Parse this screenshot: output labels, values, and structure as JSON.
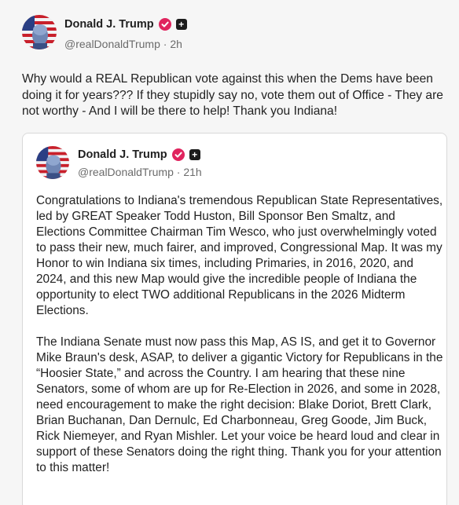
{
  "post": {
    "author_name": "Donald J. Trump",
    "handle": "@realDonaldTrump",
    "separator": " · ",
    "time": "2h",
    "text": "Why would a REAL Republican vote against this when the Dems have been doing it for years??? If they stupidly say no, vote them out of Office - They are not worthy - And I will be there to help! Thank you Indiana!"
  },
  "quoted_post": {
    "author_name": "Donald J. Trump",
    "handle": "@realDonaldTrump",
    "separator": " · ",
    "time": "21h",
    "paragraphs": [
      "Congratulations to Indiana's tremendous Republican State Representatives, led by GREAT Speaker Todd Huston, Bill Sponsor Ben Smaltz, and Elections Committee Chairman Tim Wesco, who just overwhelmingly voted to pass their new, much fairer, and improved, Congressional Map. It was my Honor to win Indiana six times, including Primaries, in 2016, 2020, and 2024, and this new Map would give the incredible people of Indiana the opportunity to elect TWO additional Republicans in the 2026 Midterm Elections.",
      "The Indiana Senate must now pass this Map, AS IS, and get it to Governor Mike Braun's desk, ASAP, to deliver a gigantic Victory for Republicans in the “Hoosier State,” and across the Country. I am hearing that these nine Senators, some of whom are up for Re-Election in 2026, and some in 2028, need encouragement to make the right decision: Blake Doriot, Brett Clark, Brian Buchanan, Dan Dernulc, Ed Charbonneau, Greg Goode, Jim Buck, Rick Niemeyer, and Ryan Mishler. Let your voice be heard loud and clear in support of these Senators doing the right thing. Thank you for your attention to this matter!"
    ]
  },
  "badges": {
    "verified_icon": "verified-check-icon",
    "plus_icon": "plus-icon",
    "plus_glyph": "+",
    "verified_color": "#e0245e"
  }
}
